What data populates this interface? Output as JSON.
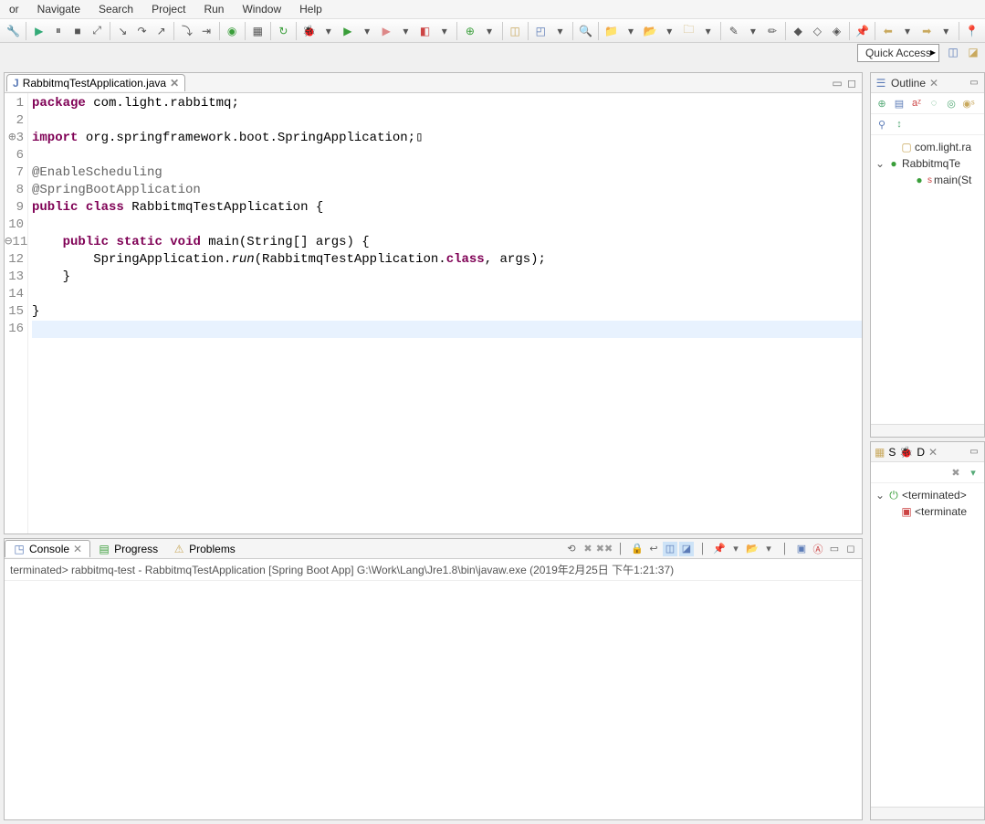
{
  "menu": [
    "or",
    "Navigate",
    "Search",
    "Project",
    "Run",
    "Window",
    "Help"
  ],
  "quick_access": "Quick Access",
  "editor": {
    "tab_label": "RabbitmqTestApplication.java",
    "lines": [
      {
        "n": "1",
        "html": "<span class='kw'>package</span> com.light.rabbitmq;"
      },
      {
        "n": "2",
        "html": ""
      },
      {
        "n": "3",
        "marker": "⊕",
        "html": "<span class='kw'>import</span> org.springframework.boot.SpringApplication;▯"
      },
      {
        "n": "6",
        "html": ""
      },
      {
        "n": "7",
        "html": "<span class='ann'>@EnableScheduling</span>"
      },
      {
        "n": "8",
        "html": "<span class='ann'>@SpringBootApplication</span>"
      },
      {
        "n": "9",
        "html": "<span class='kw'>public</span> <span class='kw'>class</span> RabbitmqTestApplication {"
      },
      {
        "n": "10",
        "html": ""
      },
      {
        "n": "11",
        "marker": "⊖",
        "html": "    <span class='kw'>public</span> <span class='kw'>static</span> <span class='kw'>void</span> main(String[] args) {"
      },
      {
        "n": "12",
        "html": "        SpringApplication.<span class='mth'>run</span>(RabbitmqTestApplication.<span class='kw'>class</span>, args);"
      },
      {
        "n": "13",
        "html": "    }"
      },
      {
        "n": "14",
        "html": ""
      },
      {
        "n": "15",
        "html": "}"
      },
      {
        "n": "16",
        "html": "",
        "cursor": true
      }
    ]
  },
  "console": {
    "tabs": [
      {
        "label": "Console",
        "active": true
      },
      {
        "label": "Progress"
      },
      {
        "label": "Problems"
      }
    ],
    "status": "terminated> rabbitmq-test - RabbitmqTestApplication [Spring Boot App] G:\\Work\\Lang\\Jre1.8\\bin\\javaw.exe (2019年2月25日 下午1:21:37)"
  },
  "outline": {
    "title": "Outline",
    "items": [
      {
        "indent": 1,
        "icon": "▢",
        "color": "#c9a95e",
        "label": "com.light.ra"
      },
      {
        "indent": 0,
        "toggle": "⌄",
        "icon": "●",
        "color": "#3a9e3a",
        "label": "RabbitmqTe"
      },
      {
        "indent": 2,
        "icon": "●",
        "color": "#3a9e3a",
        "sup": "s",
        "label": "main(St"
      }
    ]
  },
  "debug": {
    "tabs": [
      {
        "label": "S"
      },
      {
        "label": "D",
        "active": true
      }
    ],
    "tree": [
      {
        "indent": 0,
        "toggle": "⌄",
        "icon": "⏻",
        "color": "#3a9e3a",
        "label": "<terminated>"
      },
      {
        "indent": 1,
        "icon": "▣",
        "color": "#c44",
        "label": "<terminate"
      }
    ]
  }
}
